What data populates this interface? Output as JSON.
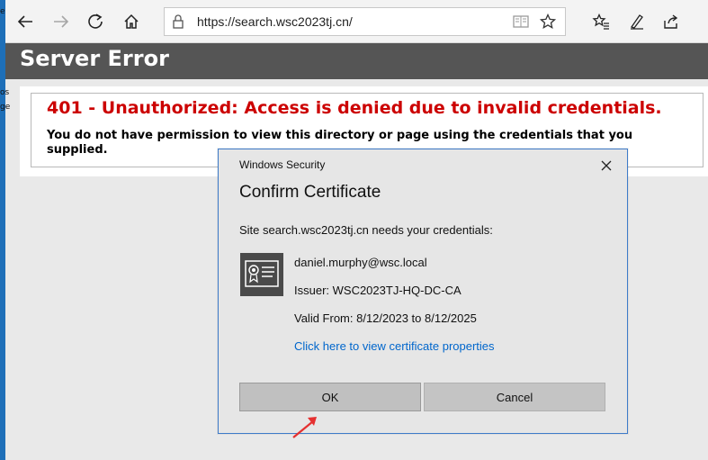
{
  "desktop": {
    "edge_glyphs": [
      "e",
      "os",
      "ge"
    ]
  },
  "browser": {
    "url": "https://search.wsc2023tj.cn/",
    "icons": {
      "back": "back-arrow-icon",
      "forward": "forward-arrow-icon",
      "refresh": "refresh-icon",
      "home": "home-icon",
      "lock": "lock-icon",
      "reader": "reading-view-icon",
      "favorite": "star-icon",
      "favorites_hub": "favorites-list-icon",
      "notes": "pen-icon",
      "share": "share-icon"
    }
  },
  "page": {
    "header_title": "Server Error",
    "error_title": "401 - Unauthorized: Access is denied due to invalid credentials.",
    "error_text": "You do not have permission to view this directory or page using the credentials that you supplied."
  },
  "dialog": {
    "caption": "Windows Security",
    "heading": "Confirm Certificate",
    "prompt": "Site search.wsc2023tj.cn needs your credentials:",
    "cert_user": "daniel.murphy@wsc.local",
    "cert_issuer": "Issuer: WSC2023TJ-HQ-DC-CA",
    "cert_valid": "Valid From: 8/12/2023 to 8/12/2025",
    "cert_link": "Click here to view certificate properties",
    "ok_label": "OK",
    "cancel_label": "Cancel"
  },
  "colors": {
    "error_red": "#cc0000",
    "link_blue": "#0066cc",
    "header_gray": "#555555",
    "annotation_red": "#e53030"
  }
}
